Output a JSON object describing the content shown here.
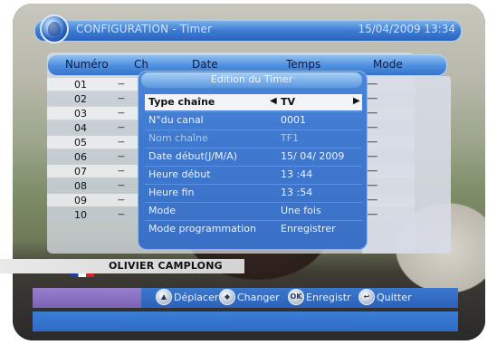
{
  "header": {
    "title": "CONFIGURATION - Timer",
    "datetime": "15/04/2009 13:34"
  },
  "list": {
    "columns": [
      "Numéro",
      "Ch",
      "Date",
      "Temps",
      "Mode"
    ],
    "rows": [
      {
        "num": "01",
        "ch": "---",
        "mode": "-----"
      },
      {
        "num": "02",
        "ch": "---",
        "mode": "-----"
      },
      {
        "num": "03",
        "ch": "---",
        "mode": "-----"
      },
      {
        "num": "04",
        "ch": "---",
        "mode": "-----"
      },
      {
        "num": "05",
        "ch": "---",
        "mode": "-----"
      },
      {
        "num": "06",
        "ch": "---",
        "mode": "-----"
      },
      {
        "num": "07",
        "ch": "---",
        "mode": "-----"
      },
      {
        "num": "08",
        "ch": "---",
        "mode": "-----"
      },
      {
        "num": "09",
        "ch": "---",
        "mode": "-----"
      },
      {
        "num": "10",
        "ch": "---",
        "mode": "-----"
      }
    ]
  },
  "dialog": {
    "title": "Edition du Timer",
    "fields": [
      {
        "label": "Type chaîne",
        "value": "TV",
        "selected": true
      },
      {
        "label": "N°du canal",
        "value": "0001"
      },
      {
        "label": "Nom chaîne",
        "value": "TF1",
        "disabled": true
      },
      {
        "label": "Date début(J/M/A)",
        "value": "15/ 04/ 2009"
      },
      {
        "label": "Heure début",
        "value": "13 :44"
      },
      {
        "label": "Heure fin",
        "value": "13 :54"
      },
      {
        "label": "Mode",
        "value": "Une fois"
      },
      {
        "label": "Mode programmation",
        "value": "Enregistrer"
      }
    ]
  },
  "background": {
    "banner_name": "OLIVIER CAMPLONG"
  },
  "hints": [
    {
      "icon": "navigate-updown-icon",
      "label": "Déplacer"
    },
    {
      "icon": "navigate-leftright-icon",
      "label": "Changer"
    },
    {
      "icon": "ok-icon",
      "icon_text": "OK",
      "label": "Enregistr"
    },
    {
      "icon": "exit-icon",
      "label": "Quitter"
    }
  ],
  "colors": {
    "accent": "#3d7bd3",
    "dialog_bg": "#3f79cf",
    "selected_row": "#f3f4f7"
  }
}
